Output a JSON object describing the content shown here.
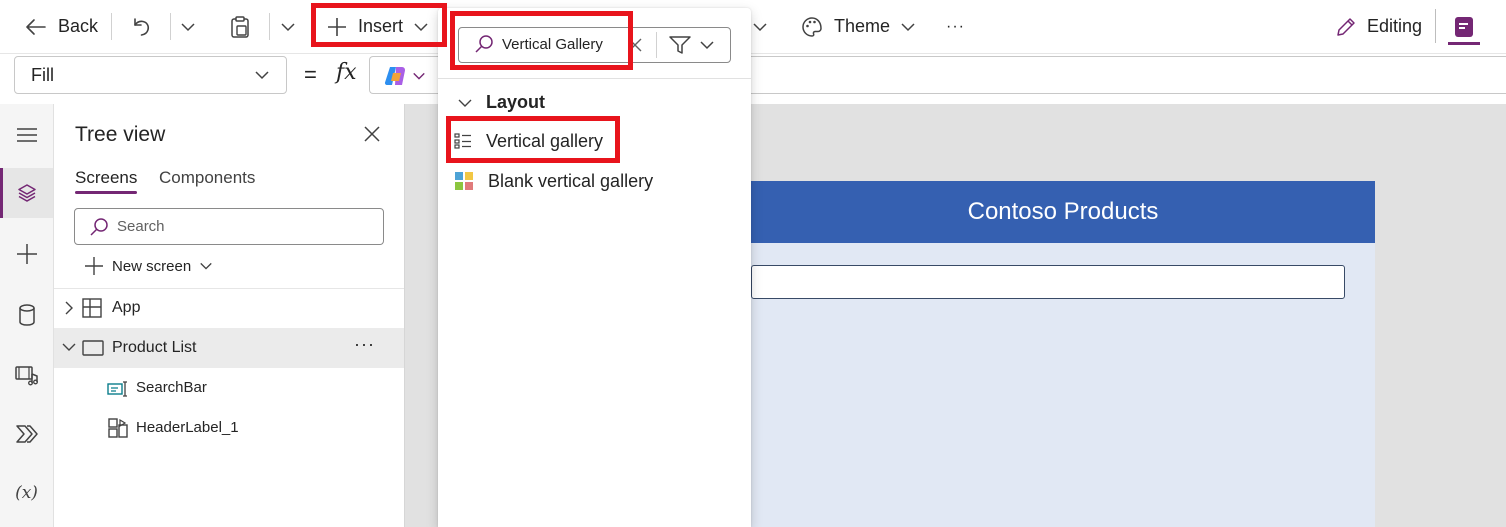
{
  "toolbar": {
    "back_label": "Back",
    "insert_label": "Insert",
    "theme_label": "Theme",
    "more_label": "···",
    "editing_label": "Editing"
  },
  "formula_bar": {
    "property_value": "Fill",
    "equals": "=",
    "fx": "fx",
    "formula": ""
  },
  "tree_view": {
    "title": "Tree view",
    "tabs": [
      {
        "label": "Screens",
        "active": true
      },
      {
        "label": "Components",
        "active": false
      }
    ],
    "search_placeholder": "Search",
    "new_screen_label": "New screen",
    "items": [
      {
        "label": "App",
        "icon": "app-icon",
        "selected": false
      },
      {
        "label": "Product List",
        "icon": "screen-icon",
        "selected": true,
        "more": "···"
      },
      {
        "label": "SearchBar",
        "icon": "text-input-icon",
        "selected": false
      },
      {
        "label": "HeaderLabel_1",
        "icon": "label-icon",
        "selected": false
      }
    ]
  },
  "rail": {
    "items": [
      "menu-icon",
      "layers-icon",
      "plus-icon",
      "database-icon",
      "media-icon",
      "power-automate-icon",
      "variables-icon"
    ],
    "variables_glyph": "(x)"
  },
  "insert_panel": {
    "search_value": "Vertical Gallery",
    "section_label": "Layout",
    "items": [
      {
        "label": "Vertical gallery",
        "icon": "vertical-gallery-icon"
      },
      {
        "label": "Blank vertical gallery",
        "icon": "blank-vertical-gallery-icon"
      }
    ]
  },
  "canvas": {
    "header_text": "Contoso Products",
    "search_value": ""
  },
  "colors": {
    "accent_purple": "#742774",
    "highlight_red": "#e8141c",
    "header_blue": "#3560b1",
    "screen_bg": "#e1e8f4"
  }
}
